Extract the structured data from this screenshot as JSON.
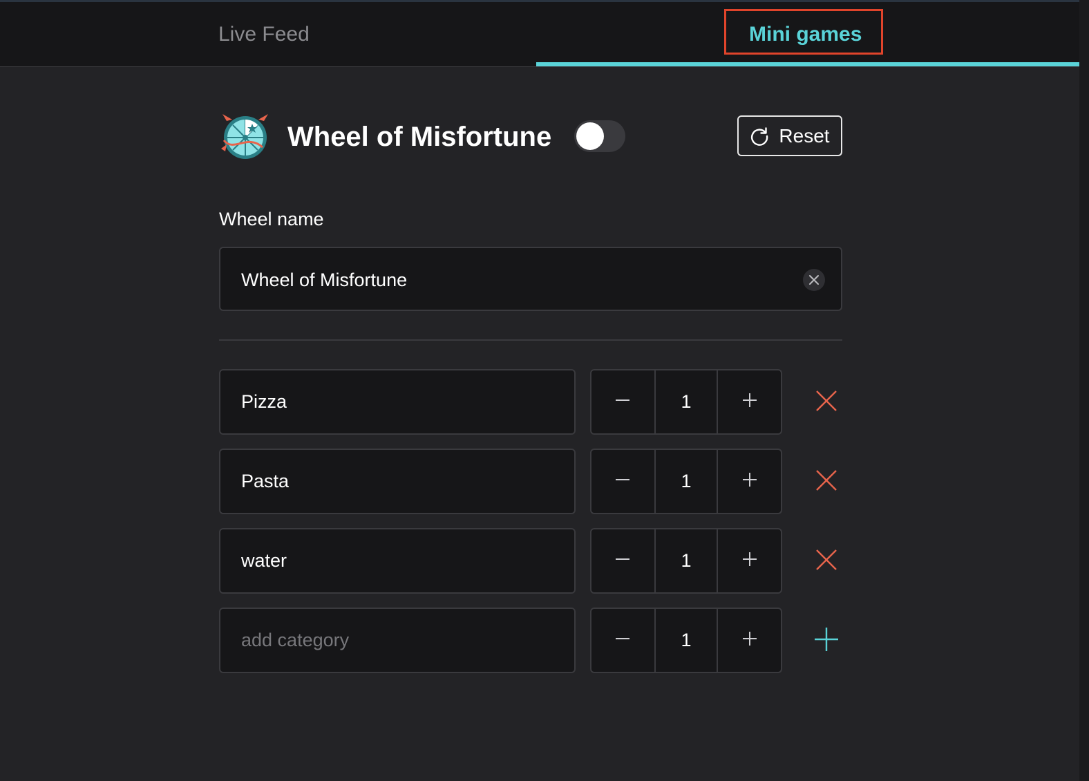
{
  "tabs": [
    {
      "label": "Live Feed",
      "active": false
    },
    {
      "label": "Mini games",
      "active": true
    }
  ],
  "game": {
    "title": "Wheel of Misfortune",
    "enabled": false,
    "reset_label": "Reset"
  },
  "wheel_name": {
    "label": "Wheel name",
    "value": "Wheel of Misfortune"
  },
  "categories": [
    {
      "name": "Pizza",
      "count": "1"
    },
    {
      "name": "Pasta",
      "count": "1"
    },
    {
      "name": "water",
      "count": "1"
    }
  ],
  "new_category": {
    "placeholder": "add category",
    "count": "1"
  },
  "colors": {
    "accent": "#5ad3d8",
    "remove": "#e8644c",
    "highlight": "#e0442b",
    "background": "#232326",
    "field": "#161618"
  },
  "icons": {
    "reset": "refresh-icon",
    "clear": "close-icon",
    "decrement": "minus-icon",
    "increment": "plus-icon",
    "remove": "close-icon",
    "add": "plus-icon"
  }
}
